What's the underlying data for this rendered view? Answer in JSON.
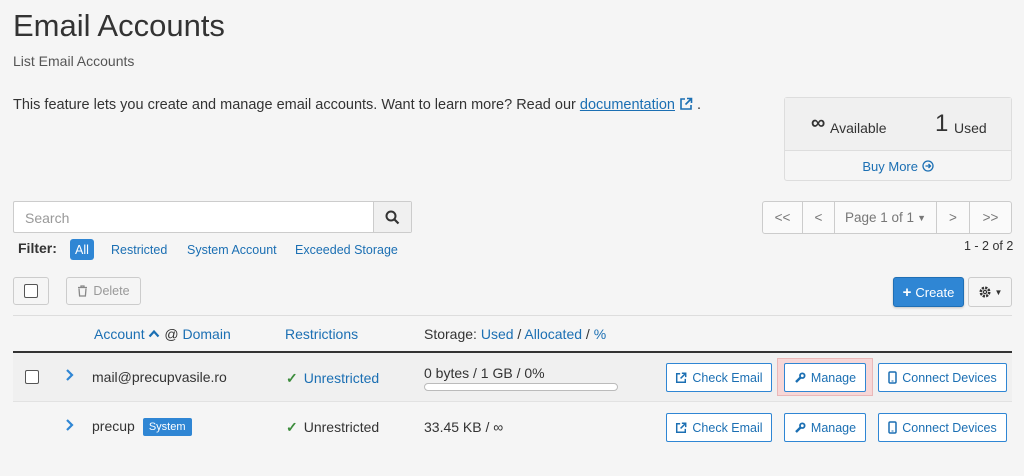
{
  "page": {
    "title": "Email Accounts",
    "subtitle": "List Email Accounts",
    "intro_text": "This feature lets you create and manage email accounts. Want to learn more? Read our ",
    "intro_link": "documentation",
    "intro_end": "."
  },
  "stats": {
    "available_symbol": "∞",
    "available_label": "Available",
    "used_count": "1",
    "used_label": "Used",
    "buy_more": "Buy More"
  },
  "search": {
    "placeholder": "Search"
  },
  "pagination": {
    "first": "<<",
    "prev": "<",
    "page_label": "Page 1 of 1",
    "next": ">",
    "last": ">>",
    "count": "1 - 2 of 2"
  },
  "filter": {
    "label": "Filter:",
    "options": [
      "All",
      "Restricted",
      "System Account",
      "Exceeded Storage"
    ],
    "selected": "All"
  },
  "toolbar": {
    "delete_label": "Delete",
    "create_label": "Create"
  },
  "table": {
    "headers": {
      "account": "Account",
      "at": "@",
      "domain": "Domain",
      "restrictions": "Restrictions",
      "storage_prefix": "Storage:",
      "used": "Used",
      "sep1": "/",
      "allocated": "Allocated",
      "sep2": "/",
      "percent": "%"
    },
    "rows": [
      {
        "account": "mail@precupvasile.ro",
        "badge": "",
        "restriction": "Unrestricted",
        "restriction_is_link": true,
        "storage": "0 bytes / 1 GB / 0%",
        "storage_fraction": 0,
        "actions": {
          "check": "Check Email",
          "manage": "Manage",
          "connect": "Connect Devices"
        }
      },
      {
        "account": "precup",
        "badge": "System",
        "restriction": "Unrestricted",
        "restriction_is_link": false,
        "storage": "33.45 KB / ∞",
        "actions": {
          "check": "Check Email",
          "manage": "Manage",
          "connect": "Connect Devices"
        }
      }
    ]
  },
  "colors": {
    "accent": "#2f86d4",
    "link": "#1b6fb3",
    "success": "#3c8c3c",
    "highlight": "#f7d7d7"
  }
}
